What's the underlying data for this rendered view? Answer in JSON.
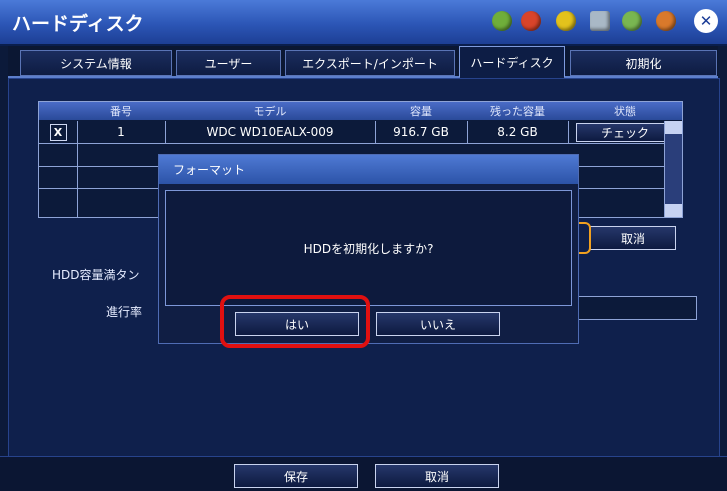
{
  "window": {
    "title": "ハードディスク",
    "close_glyph": "✕"
  },
  "toolbar_icons": [
    {
      "name": "network-icon",
      "color": "#6fae3a"
    },
    {
      "name": "record-icon",
      "color": "#d8442a"
    },
    {
      "name": "settings-icon",
      "color": "#e3c21c"
    },
    {
      "name": "tools-icon",
      "color": "#a9b8c6"
    },
    {
      "name": "search-icon",
      "color": "#79b651"
    },
    {
      "name": "exit-icon",
      "color": "#d9792b"
    }
  ],
  "tabs": [
    {
      "label": "システム情報",
      "active": false
    },
    {
      "label": "ユーザー",
      "active": false
    },
    {
      "label": "エクスポート/インポート",
      "active": false
    },
    {
      "label": "ハードディスク",
      "active": true
    },
    {
      "label": "初期化",
      "active": false
    }
  ],
  "hdd_table": {
    "headers": [
      "番号",
      "モデル",
      "容量",
      "残った容量",
      "状態"
    ],
    "rows": [
      {
        "select": "X",
        "number": "1",
        "model": "WDC WD10EALX-009",
        "capacity": "916.7 GB",
        "remaining": "8.2 GB",
        "status": "チェック"
      }
    ]
  },
  "labels": {
    "hdd_full": "HDD容量満タン",
    "progress": "進行率"
  },
  "buttons": {
    "cancel_side": "取消",
    "save": "保存",
    "cancel_bottom": "取消"
  },
  "dialog": {
    "title": "フォーマット",
    "message": "HDDを初期化しますか?",
    "yes": "はい",
    "no": "いいえ"
  },
  "colors": {
    "highlight": "#e01010",
    "title_bar": "#2c56b6"
  }
}
